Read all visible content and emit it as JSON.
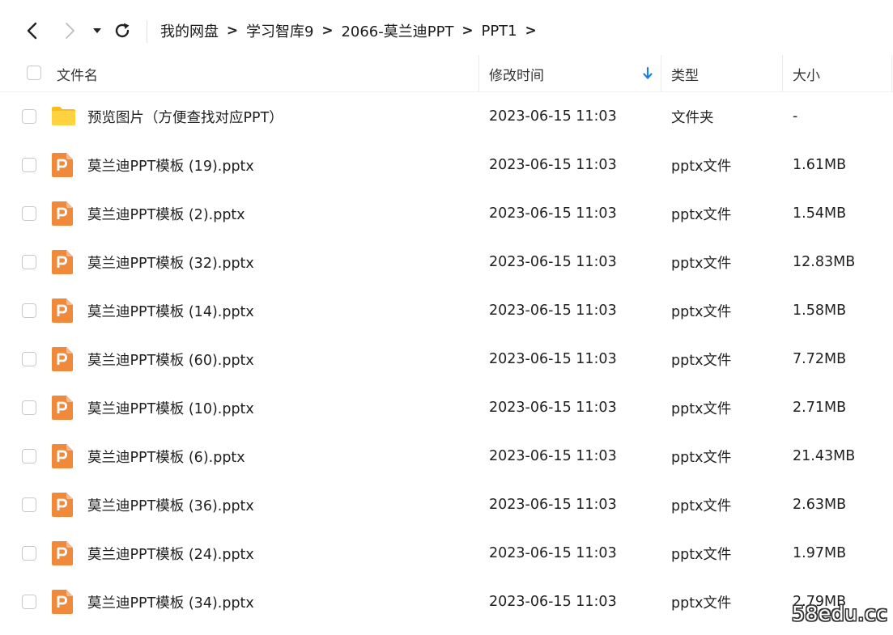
{
  "toolbar": {
    "back_icon": "chevron-left-icon",
    "forward_icon": "chevron-right-icon",
    "dropdown_icon": "caret-down-icon",
    "refresh_icon": "refresh-icon"
  },
  "breadcrumb": {
    "items": [
      "我的网盘",
      "学习智库9",
      "2066-莫兰迪PPT",
      "PPT1"
    ],
    "separator": ">"
  },
  "columns": {
    "name": "文件名",
    "modified": "修改时间",
    "type": "类型",
    "size": "大小",
    "sort_icon": "sort-descending-arrow-icon"
  },
  "colors": {
    "accent": "#1b7fe6",
    "folder": "#ffcb2f",
    "pptx_icon": "#f08a3a"
  },
  "files": [
    {
      "name": "预览图片（方便查找对应PPT）",
      "modified": "2023-06-15 11:03",
      "type": "文件夹",
      "size": "-",
      "icon": "folder-icon"
    },
    {
      "name": "莫兰迪PPT模板 (19).pptx",
      "modified": "2023-06-15 11:03",
      "type": "pptx文件",
      "size": "1.61MB",
      "icon": "pptx-file-icon"
    },
    {
      "name": "莫兰迪PPT模板 (2).pptx",
      "modified": "2023-06-15 11:03",
      "type": "pptx文件",
      "size": "1.54MB",
      "icon": "pptx-file-icon"
    },
    {
      "name": "莫兰迪PPT模板 (32).pptx",
      "modified": "2023-06-15 11:03",
      "type": "pptx文件",
      "size": "12.83MB",
      "icon": "pptx-file-icon"
    },
    {
      "name": "莫兰迪PPT模板 (14).pptx",
      "modified": "2023-06-15 11:03",
      "type": "pptx文件",
      "size": "1.58MB",
      "icon": "pptx-file-icon"
    },
    {
      "name": "莫兰迪PPT模板 (60).pptx",
      "modified": "2023-06-15 11:03",
      "type": "pptx文件",
      "size": "7.72MB",
      "icon": "pptx-file-icon"
    },
    {
      "name": "莫兰迪PPT模板 (10).pptx",
      "modified": "2023-06-15 11:03",
      "type": "pptx文件",
      "size": "2.71MB",
      "icon": "pptx-file-icon"
    },
    {
      "name": "莫兰迪PPT模板 (6).pptx",
      "modified": "2023-06-15 11:03",
      "type": "pptx文件",
      "size": "21.43MB",
      "icon": "pptx-file-icon"
    },
    {
      "name": "莫兰迪PPT模板 (36).pptx",
      "modified": "2023-06-15 11:03",
      "type": "pptx文件",
      "size": "2.63MB",
      "icon": "pptx-file-icon"
    },
    {
      "name": "莫兰迪PPT模板 (24).pptx",
      "modified": "2023-06-15 11:03",
      "type": "pptx文件",
      "size": "1.97MB",
      "icon": "pptx-file-icon"
    },
    {
      "name": "莫兰迪PPT模板 (34).pptx",
      "modified": "2023-06-15 11:03",
      "type": "pptx文件",
      "size": "2.79MB",
      "icon": "pptx-file-icon"
    }
  ],
  "watermark": "58edu.cc"
}
